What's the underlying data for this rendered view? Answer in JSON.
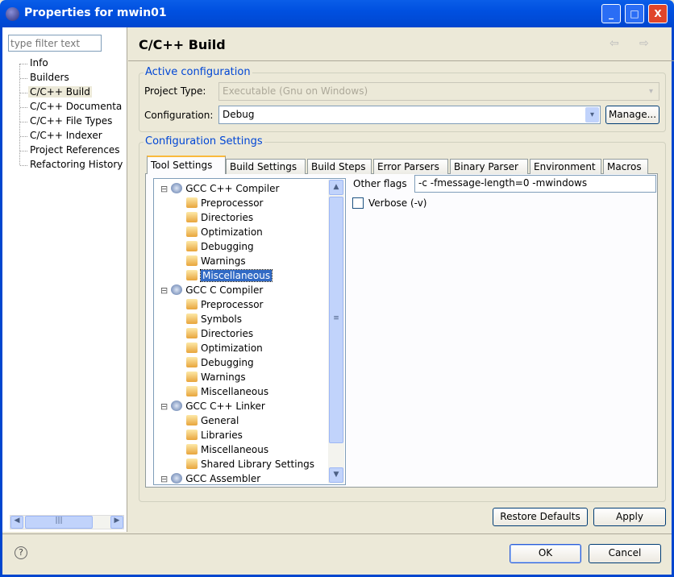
{
  "window": {
    "title": "Properties for mwin01",
    "minimize": "_",
    "maximize": "□",
    "close": "X"
  },
  "sidebar": {
    "filter_placeholder": "type filter text",
    "items": [
      {
        "label": "Info"
      },
      {
        "label": "Builders"
      },
      {
        "label": "C/C++ Build",
        "selected": true
      },
      {
        "label": "C/C++ Documenta"
      },
      {
        "label": "C/C++ File Types"
      },
      {
        "label": "C/C++ Indexer"
      },
      {
        "label": "Project References"
      },
      {
        "label": "Refactoring History"
      }
    ]
  },
  "header": {
    "title": "C/C++ Build",
    "back": "⇦",
    "forward": "⇨"
  },
  "active_config": {
    "legend": "Active configuration",
    "project_type_label": "Project Type:",
    "project_type_value": "Executable (Gnu on Windows)",
    "configuration_label": "Configuration:",
    "configuration_value": "Debug",
    "manage_label": "Manage..."
  },
  "config_settings": {
    "legend": "Configuration Settings",
    "tabs": [
      {
        "label": "Tool Settings",
        "active": true
      },
      {
        "label": "Build Settings"
      },
      {
        "label": "Build Steps"
      },
      {
        "label": "Error Parsers"
      },
      {
        "label": "Binary Parser"
      },
      {
        "label": "Environment"
      },
      {
        "label": "Macros"
      }
    ],
    "tree": [
      {
        "label": "GCC C++ Compiler",
        "level": 0
      },
      {
        "label": "Preprocessor",
        "level": 1
      },
      {
        "label": "Directories",
        "level": 1
      },
      {
        "label": "Optimization",
        "level": 1
      },
      {
        "label": "Debugging",
        "level": 1
      },
      {
        "label": "Warnings",
        "level": 1
      },
      {
        "label": "Miscellaneous",
        "level": 1,
        "selected": true
      },
      {
        "label": "GCC C Compiler",
        "level": 0
      },
      {
        "label": "Preprocessor",
        "level": 1
      },
      {
        "label": "Symbols",
        "level": 1
      },
      {
        "label": "Directories",
        "level": 1
      },
      {
        "label": "Optimization",
        "level": 1
      },
      {
        "label": "Debugging",
        "level": 1
      },
      {
        "label": "Warnings",
        "level": 1
      },
      {
        "label": "Miscellaneous",
        "level": 1
      },
      {
        "label": "GCC C++ Linker",
        "level": 0
      },
      {
        "label": "General",
        "level": 1
      },
      {
        "label": "Libraries",
        "level": 1
      },
      {
        "label": "Miscellaneous",
        "level": 1
      },
      {
        "label": "Shared Library Settings",
        "level": 1
      },
      {
        "label": "GCC Assembler",
        "level": 0
      }
    ],
    "other_flags_label": "Other flags",
    "other_flags_value": "-c -fmessage-length=0 -mwindows",
    "verbose_label": "Verbose (-v)",
    "verbose_checked": false
  },
  "buttons": {
    "restore_defaults": "Restore Defaults",
    "apply": "Apply",
    "ok": "OK",
    "cancel": "Cancel",
    "help": "?"
  }
}
